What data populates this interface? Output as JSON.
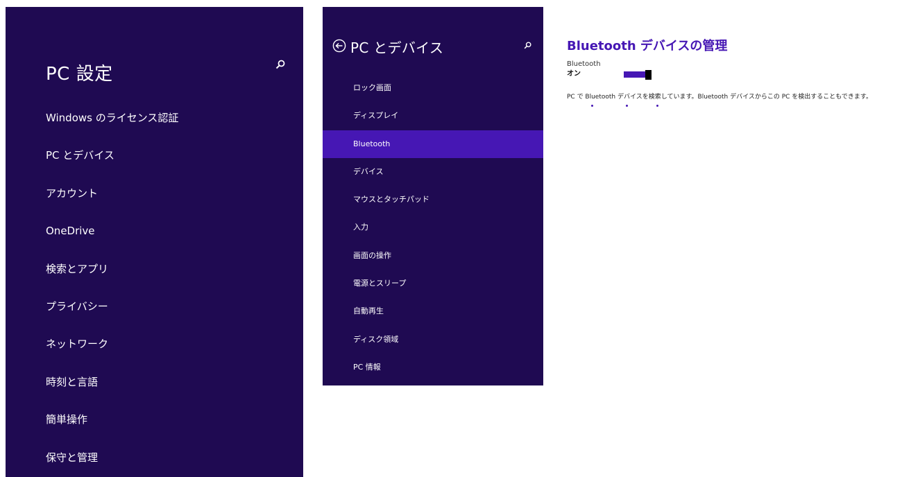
{
  "colors": {
    "panel_bg": "#1f0a52",
    "accent": "#4617b4",
    "page_bg": "#ffffff"
  },
  "pc_settings": {
    "title": "PC 設定",
    "search_icon": "search-icon",
    "items": [
      {
        "label": "Windows のライセンス認証"
      },
      {
        "label": "PC とデバイス"
      },
      {
        "label": "アカウント"
      },
      {
        "label": "OneDrive"
      },
      {
        "label": "検索とアプリ"
      },
      {
        "label": "プライバシー"
      },
      {
        "label": "ネットワーク"
      },
      {
        "label": "時刻と言語"
      },
      {
        "label": "簡単操作"
      },
      {
        "label": "保守と管理"
      }
    ]
  },
  "pc_devices": {
    "title": "PC とデバイス",
    "back_icon": "back-arrow-icon",
    "search_icon": "search-icon",
    "items": [
      {
        "label": "ロック画面"
      },
      {
        "label": "ディスプレイ"
      },
      {
        "label": "Bluetooth",
        "selected": true
      },
      {
        "label": "デバイス"
      },
      {
        "label": "マウスとタッチパッド"
      },
      {
        "label": "入力"
      },
      {
        "label": "画面の操作"
      },
      {
        "label": "電源とスリープ"
      },
      {
        "label": "自動再生"
      },
      {
        "label": "ディスク領域"
      },
      {
        "label": "PC 情報"
      }
    ]
  },
  "bluetooth": {
    "heading": "Bluetooth デバイスの管理",
    "toggle_label": "Bluetooth",
    "toggle_state": "オン",
    "toggle_on": true,
    "status_text": "PC で Bluetooth デバイスを検索しています。Bluetooth デバイスからこの PC を検出することもできます。"
  }
}
